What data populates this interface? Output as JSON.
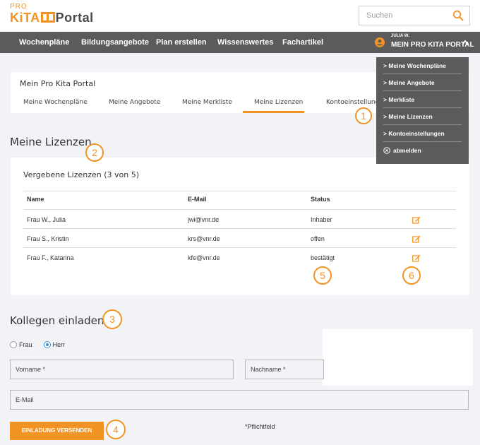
{
  "header": {
    "logo_pro": "PRO",
    "logo_kita": "KiTA",
    "logo_portal": "Portal",
    "search_placeholder": "Suchen"
  },
  "nav": {
    "items": [
      "Wochenpläne",
      "Bildungsangebote",
      "Plan erstellen",
      "Wissenswertes",
      "Fachartikel"
    ],
    "user_small": "JULIA W.",
    "user_big": "MEIN PRO KITA PORTAL"
  },
  "dropdown": {
    "items": [
      "> Meine Wochenpläne",
      "> Meine Angebote",
      "> Merkliste",
      "> Meine Lizenzen",
      "> Kontoeinstellungen"
    ],
    "logout": "abmelden"
  },
  "portal": {
    "title": "Mein Pro Kita Portal",
    "tabs": [
      "Meine Wochenpläne",
      "Meine Angebote",
      "Meine Merkliste",
      "Meine Lizenzen",
      "Kontoeinstellungen"
    ],
    "active_tab": "Meine Lizenzen"
  },
  "licenses": {
    "heading": "Meine Lizenzen",
    "subtitle": "Vergebene Lizenzen (3 von 5)",
    "columns": [
      "Name",
      "E-Mail",
      "Status"
    ],
    "rows": [
      {
        "name": "Frau W., Julia",
        "email": "jwi@vnr.de",
        "status": "Inhaber"
      },
      {
        "name": "Frau S., Kristin",
        "email": "krs@vnr.de",
        "status": "offen"
      },
      {
        "name": "Frau F., Katarina",
        "email": "kfe@vnr.de",
        "status": "bestätigt"
      }
    ]
  },
  "invite": {
    "heading": "Kollegen einladen",
    "radio_frau": "Frau",
    "radio_herr": "Herr",
    "selected": "Herr",
    "vorname_placeholder": "Vorname *",
    "nachname_placeholder": "Nachname *",
    "email_placeholder": "E-Mail",
    "send_label": "EINLADUNG VERSENDEN",
    "required_note": "*Pflichtfeld"
  },
  "badges": [
    "1",
    "2",
    "3",
    "4",
    "5",
    "6"
  ],
  "colors": {
    "accent": "#f39323",
    "nav_bg": "#5b5b5b",
    "page_bg": "#f1f3f7",
    "radio_checked": "#3a8fd6"
  }
}
